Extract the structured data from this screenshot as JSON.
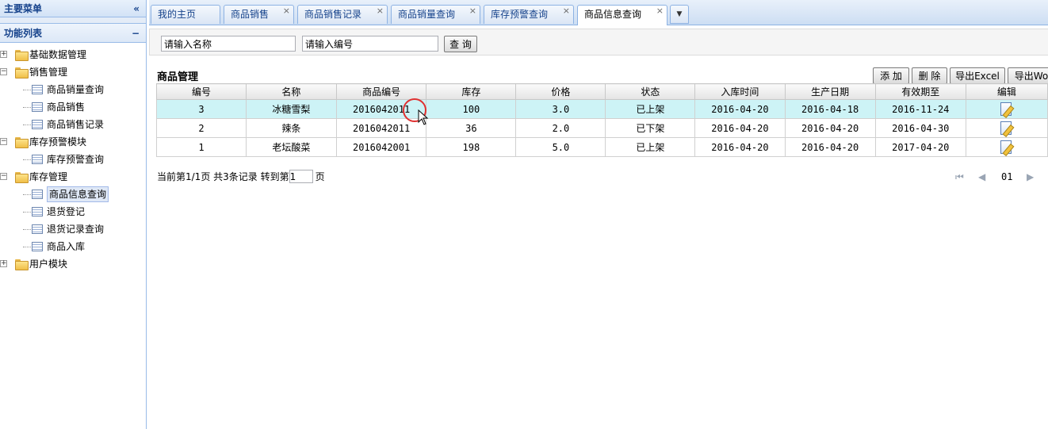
{
  "sidebar": {
    "title": "主要菜单",
    "collapse_icon": "«",
    "section_title": "功能列表",
    "section_tool": "−",
    "items": [
      {
        "label": "基础数据管理",
        "type": "folder",
        "level": 0,
        "expanded": false
      },
      {
        "label": "销售管理",
        "type": "folder",
        "level": 0,
        "expanded": true
      },
      {
        "label": "商品销量查询",
        "type": "page",
        "level": 1
      },
      {
        "label": "商品销售",
        "type": "page",
        "level": 1
      },
      {
        "label": "商品销售记录",
        "type": "page",
        "level": 1
      },
      {
        "label": "库存预警模块",
        "type": "folder",
        "level": 0,
        "expanded": true
      },
      {
        "label": "库存预警查询",
        "type": "page",
        "level": 1
      },
      {
        "label": "库存管理",
        "type": "folder",
        "level": 0,
        "expanded": true
      },
      {
        "label": "商品信息查询",
        "type": "page",
        "level": 1,
        "selected": true
      },
      {
        "label": "退货登记",
        "type": "page",
        "level": 1
      },
      {
        "label": "退货记录查询",
        "type": "page",
        "level": 1
      },
      {
        "label": "商品入库",
        "type": "page",
        "level": 1
      },
      {
        "label": "用户模块",
        "type": "folder",
        "level": 0,
        "expanded": false
      }
    ]
  },
  "tabs": [
    {
      "label": "我的主页",
      "closable": false
    },
    {
      "label": "商品销售",
      "closable": true
    },
    {
      "label": "商品销售记录",
      "closable": true
    },
    {
      "label": "商品销量查询",
      "closable": true
    },
    {
      "label": "库存预警查询",
      "closable": true
    },
    {
      "label": "商品信息查询",
      "closable": true,
      "active": true
    }
  ],
  "tab_close_glyph": "×",
  "tab_more_glyph": "▼",
  "search": {
    "name_value": "请输入名称",
    "code_value": "请输入编号",
    "button": "查 询"
  },
  "grid": {
    "title": "商品管理",
    "toolbar": {
      "add": "添 加",
      "delete": "删 除",
      "export_excel": "导出Excel",
      "export_word": "导出Wo"
    },
    "columns": [
      "编号",
      "名称",
      "商品编号",
      "库存",
      "价格",
      "状态",
      "入库时间",
      "生产日期",
      "有效期至",
      "编辑"
    ],
    "rows": [
      [
        "3",
        "冰糖雪梨",
        "2016042011",
        "100",
        "3.0",
        "已上架",
        "2016-04-20",
        "2016-04-18",
        "2016-11-24"
      ],
      [
        "2",
        "辣条",
        "2016042011",
        "36",
        "2.0",
        "已下架",
        "2016-04-20",
        "2016-04-20",
        "2016-04-30"
      ],
      [
        "1",
        "老坛酸菜",
        "2016042001",
        "198",
        "5.0",
        "已上架",
        "2016-04-20",
        "2016-04-20",
        "2017-04-20"
      ]
    ],
    "selected_row": 0
  },
  "pager": {
    "text_before": "当前第1/1页 共3条记录 转到第",
    "page_input": "1",
    "text_after": "页",
    "page_number": "01",
    "first_icon": "⏮",
    "prev_icon": "◀",
    "next_icon": "▶"
  }
}
